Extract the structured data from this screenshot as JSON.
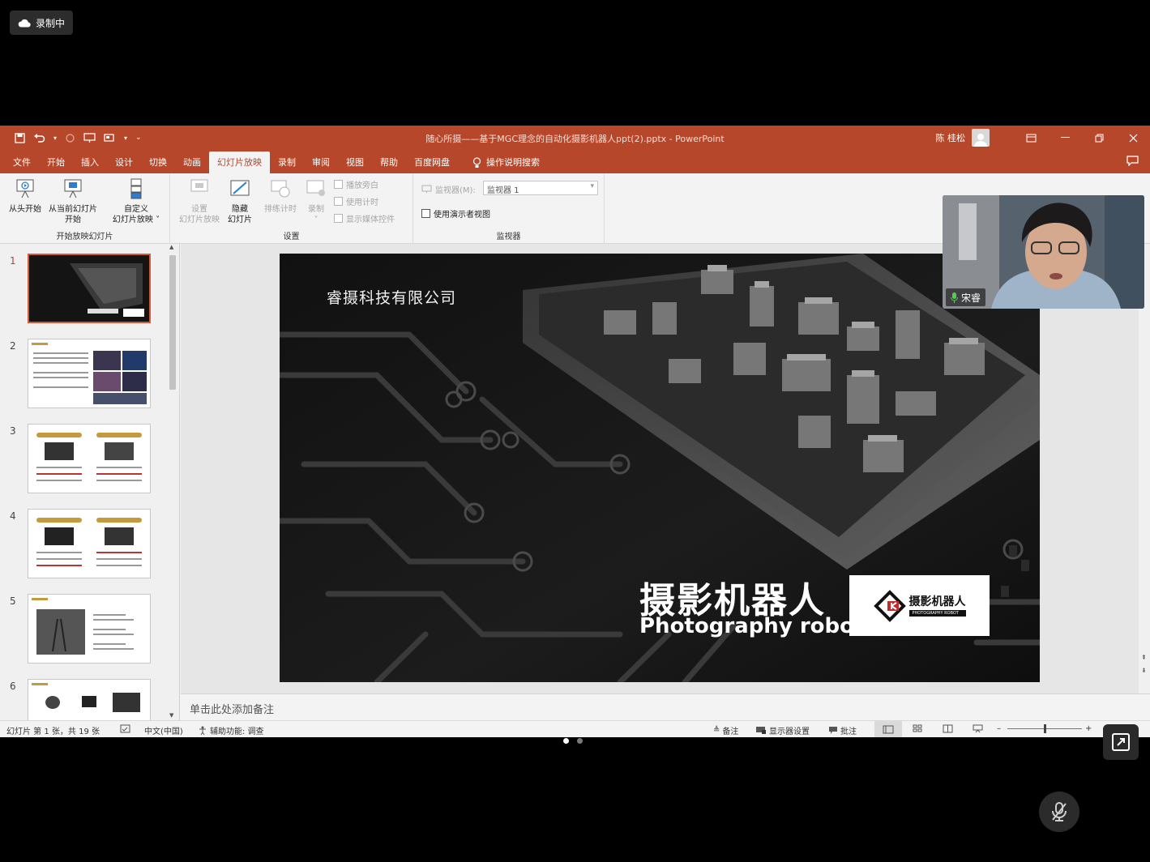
{
  "recording": {
    "label": "录制中"
  },
  "window": {
    "title": "随心所摄——基于MGC理念的自动化摄影机器人ppt(2).pptx  -  PowerPoint",
    "user_name": "陈 桂松"
  },
  "tabs": [
    {
      "label": "文件"
    },
    {
      "label": "开始"
    },
    {
      "label": "插入"
    },
    {
      "label": "设计"
    },
    {
      "label": "切换"
    },
    {
      "label": "动画"
    },
    {
      "label": "幻灯片放映"
    },
    {
      "label": "录制"
    },
    {
      "label": "审阅"
    },
    {
      "label": "视图"
    },
    {
      "label": "帮助"
    },
    {
      "label": "百度网盘"
    }
  ],
  "search_tab": {
    "label": "操作说明搜索"
  },
  "ribbon": {
    "start_group": {
      "label": "开始放映幻灯片",
      "from_start": "从头开始",
      "from_current_1": "从当前幻灯片",
      "from_current_2": "开始",
      "custom_1": "自定义",
      "custom_2": "幻灯片放映 ˅"
    },
    "setup_group": {
      "label": "设置",
      "setup_1": "设置",
      "setup_2": "幻灯片放映",
      "hide_1": "隐藏",
      "hide_2": "幻灯片",
      "rehearse": "排练计时",
      "record": "录制",
      "record_arrow": "˅",
      "play_narration": "播放旁白",
      "use_timings": "使用计时",
      "show_media": "显示媒体控件"
    },
    "monitor_group": {
      "label": "监视器",
      "monitor_label": "监视器(M):",
      "monitor_value": "监视器 1",
      "presenter_view": "使用演示者视图"
    }
  },
  "thumbnails": [
    {
      "num": "1"
    },
    {
      "num": "2"
    },
    {
      "num": "3"
    },
    {
      "num": "4"
    },
    {
      "num": "5"
    },
    {
      "num": "6"
    }
  ],
  "slide": {
    "company": "睿摄科技有限公司",
    "title": "摄影机器人",
    "subtitle": "Photography robot",
    "logo_text": "摄影机器人",
    "logo_sub": "PHOTOGRAPHY ROBOT"
  },
  "notes": {
    "placeholder": "单击此处添加备注"
  },
  "status": {
    "slide_info": "幻灯片 第 1 张，共 19 张",
    "language": "中文(中国)",
    "accessibility": "辅助功能: 调查",
    "notes": "备注",
    "display_settings": "显示器设置",
    "comments": "批注"
  },
  "video": {
    "participant": "宋睿"
  },
  "colors": {
    "accent": "#b7472a",
    "background": "#000000"
  }
}
